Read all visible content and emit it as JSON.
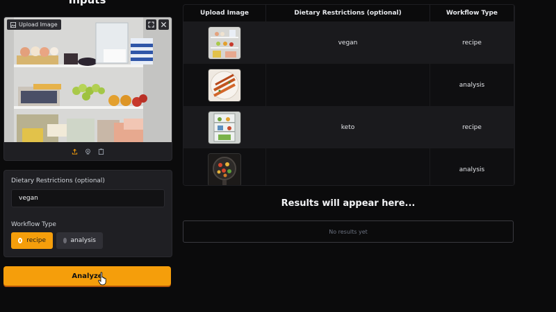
{
  "inputs": {
    "title": "Inputs"
  },
  "image_upload": {
    "label": "Upload Image"
  },
  "form": {
    "dietary_label": "Dietary Restrictions (optional)",
    "dietary_value": "vegan",
    "workflow_label": "Workflow Type",
    "workflow_options": [
      "recipe",
      "analysis"
    ],
    "workflow_selected": "recipe"
  },
  "analyze_button": {
    "label": "Analyze"
  },
  "examples": {
    "headers": [
      "Upload Image",
      "Dietary Restrictions (optional)",
      "Workflow Type"
    ],
    "rows": [
      {
        "thumb": "fridge-shelves-thumbnail",
        "diet": "vegan",
        "workflow": "recipe"
      },
      {
        "thumb": "kebab-skewers-thumbnail",
        "diet": "",
        "workflow": "analysis"
      },
      {
        "thumb": "open-fridge-thumbnail",
        "diet": "keto",
        "workflow": "recipe"
      },
      {
        "thumb": "skillet-dish-thumbnail",
        "diet": "",
        "workflow": "analysis"
      }
    ]
  },
  "results": {
    "title": "Results will appear here...",
    "placeholder": "No results yet"
  },
  "colors": {
    "accent": "#f59e0b",
    "background": "#0b0b0c",
    "panel": "#1f1f23"
  },
  "icons": [
    "image-icon",
    "fullscreen-icon",
    "close-icon",
    "upload-icon",
    "webcam-icon",
    "clipboard-icon",
    "pointer-cursor-icon"
  ]
}
